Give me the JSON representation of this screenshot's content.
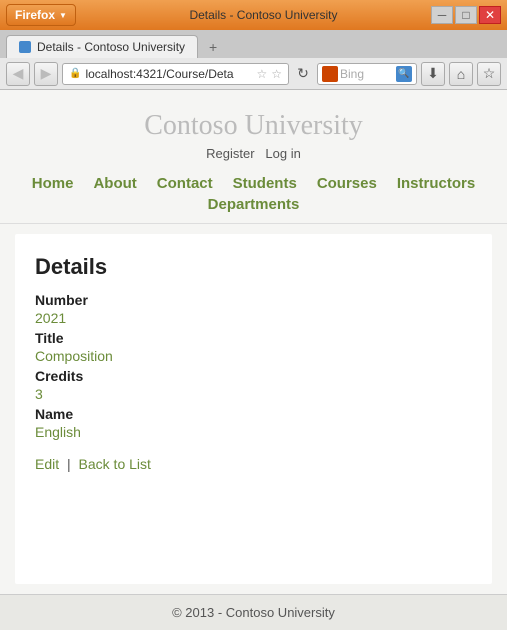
{
  "window": {
    "browser_label": "Firefox",
    "tab_title": "Details - Contoso University",
    "new_tab_label": "+",
    "url": "localhost:4321/Course/Deta",
    "search_placeholder": "Bing"
  },
  "nav": {
    "back_label": "◀",
    "forward_label": "▶",
    "refresh_label": "↻",
    "home_label": "⌂",
    "download_label": "⬇",
    "star_label": "☆"
  },
  "site": {
    "title": "Contoso University",
    "auth": {
      "register": "Register",
      "login": "Log in"
    },
    "nav_links": [
      "Home",
      "About",
      "Contact",
      "Students",
      "Courses",
      "Instructors",
      "Departments"
    ]
  },
  "page": {
    "heading": "Details",
    "fields": [
      {
        "label": "Number",
        "value": "2021"
      },
      {
        "label": "Title",
        "value": "Composition"
      },
      {
        "label": "Credits",
        "value": "3"
      },
      {
        "label": "Name",
        "value": "English"
      }
    ],
    "actions": {
      "edit": "Edit",
      "separator": "|",
      "back": "Back to List"
    }
  },
  "footer": {
    "text": "© 2013 - Contoso University"
  }
}
